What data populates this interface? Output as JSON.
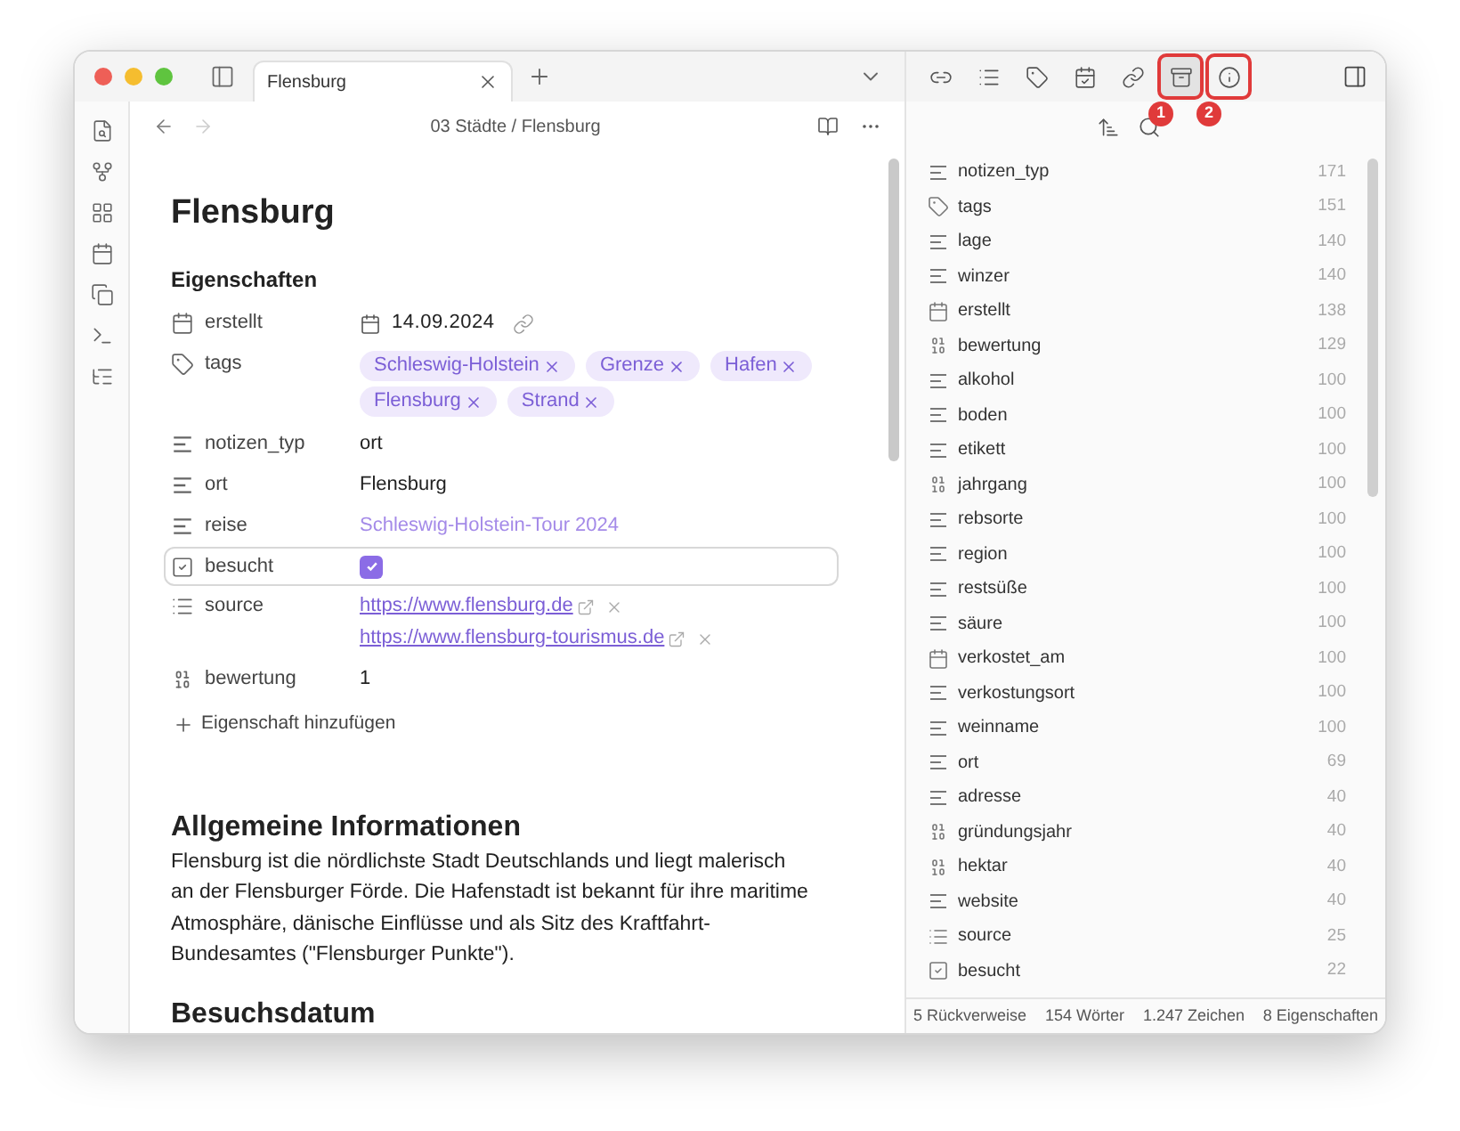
{
  "tab_bar": {
    "tabs": [
      {
        "title": "Flensburg",
        "selected": true
      }
    ]
  },
  "editor": {
    "breadcrumb": "03 Städte / Flensburg",
    "title": "Flensburg",
    "properties_heading": "Eigenschaften",
    "properties": [
      {
        "name": "erstellt",
        "kind": "date",
        "value": "14.09.2024",
        "focused": false
      },
      {
        "name": "tags",
        "kind": "tags",
        "tags": [
          "Schleswig-Holstein",
          "Grenze",
          "Hafen",
          "Flensburg",
          "Strand"
        ],
        "focused": false
      },
      {
        "name": "notizen_typ",
        "kind": "text",
        "value": "ort",
        "is_link": false,
        "focused": false
      },
      {
        "name": "ort",
        "kind": "text",
        "value": "Flensburg",
        "is_link": false,
        "focused": false
      },
      {
        "name": "reise",
        "kind": "text",
        "value": "Schleswig-Holstein-Tour 2024",
        "is_link": true,
        "focused": false
      },
      {
        "name": "besucht",
        "kind": "checkbox",
        "checked": true,
        "focused": true
      },
      {
        "name": "source",
        "kind": "list",
        "values": [
          "https://www.flensburg.de",
          "https://www.flensburg-tourismus.de"
        ],
        "focused": false
      },
      {
        "name": "bewertung",
        "kind": "number",
        "value": "1",
        "focused": false
      }
    ],
    "add_property": "Eigenschaft hinzufügen",
    "sections": [
      {
        "heading": "Allgemeine Informationen",
        "paragraph": "Flensburg ist die nördlichste Stadt Deutschlands und liegt malerisch an der Flensburger Förde. Die Hafenstadt ist bekannt für ihre maritime Atmosphäre, dänische Einflüsse und als Sitz des Kraftfahrt-Bundesamtes (\"Flensburger Punkte\")."
      },
      {
        "heading": "Besuchsdatum"
      }
    ]
  },
  "right_panel": {
    "toolbar": [
      {
        "kind": "backlinks",
        "selected": false,
        "highlighted": false
      },
      {
        "kind": "outline",
        "selected": false,
        "highlighted": false
      },
      {
        "kind": "tags",
        "selected": false,
        "highlighted": false
      },
      {
        "kind": "calendar",
        "selected": false,
        "highlighted": false
      },
      {
        "kind": "outgoing",
        "selected": false,
        "highlighted": false
      },
      {
        "kind": "archive",
        "selected": true,
        "highlighted": true,
        "badge": "1"
      },
      {
        "kind": "info",
        "selected": false,
        "highlighted": true,
        "badge": "2"
      }
    ],
    "properties": [
      {
        "name": "notizen_typ",
        "kind": "text",
        "count": "171"
      },
      {
        "name": "tags",
        "kind": "tags",
        "count": "151"
      },
      {
        "name": "lage",
        "kind": "text",
        "count": "140"
      },
      {
        "name": "winzer",
        "kind": "text",
        "count": "140"
      },
      {
        "name": "erstellt",
        "kind": "date",
        "count": "138"
      },
      {
        "name": "bewertung",
        "kind": "number",
        "count": "129"
      },
      {
        "name": "alkohol",
        "kind": "text",
        "count": "100"
      },
      {
        "name": "boden",
        "kind": "text",
        "count": "100"
      },
      {
        "name": "etikett",
        "kind": "text",
        "count": "100"
      },
      {
        "name": "jahrgang",
        "kind": "number",
        "count": "100"
      },
      {
        "name": "rebsorte",
        "kind": "text",
        "count": "100"
      },
      {
        "name": "region",
        "kind": "text",
        "count": "100"
      },
      {
        "name": "restsüße",
        "kind": "text",
        "count": "100"
      },
      {
        "name": "säure",
        "kind": "text",
        "count": "100"
      },
      {
        "name": "verkostet_am",
        "kind": "date",
        "count": "100"
      },
      {
        "name": "verkostungsort",
        "kind": "text",
        "count": "100"
      },
      {
        "name": "weinname",
        "kind": "text",
        "count": "100"
      },
      {
        "name": "ort",
        "kind": "text",
        "count": "69"
      },
      {
        "name": "adresse",
        "kind": "text",
        "count": "40"
      },
      {
        "name": "gründungsjahr",
        "kind": "number",
        "count": "40"
      },
      {
        "name": "hektar",
        "kind": "number",
        "count": "40"
      },
      {
        "name": "website",
        "kind": "text",
        "count": "40"
      },
      {
        "name": "source",
        "kind": "list",
        "count": "25"
      },
      {
        "name": "besucht",
        "kind": "checkbox",
        "count": "22"
      }
    ],
    "status_bar": [
      "5 Rückverweise",
      "154 Wörter",
      "1.247 Zeichen",
      "8 Eigenschaften"
    ]
  }
}
